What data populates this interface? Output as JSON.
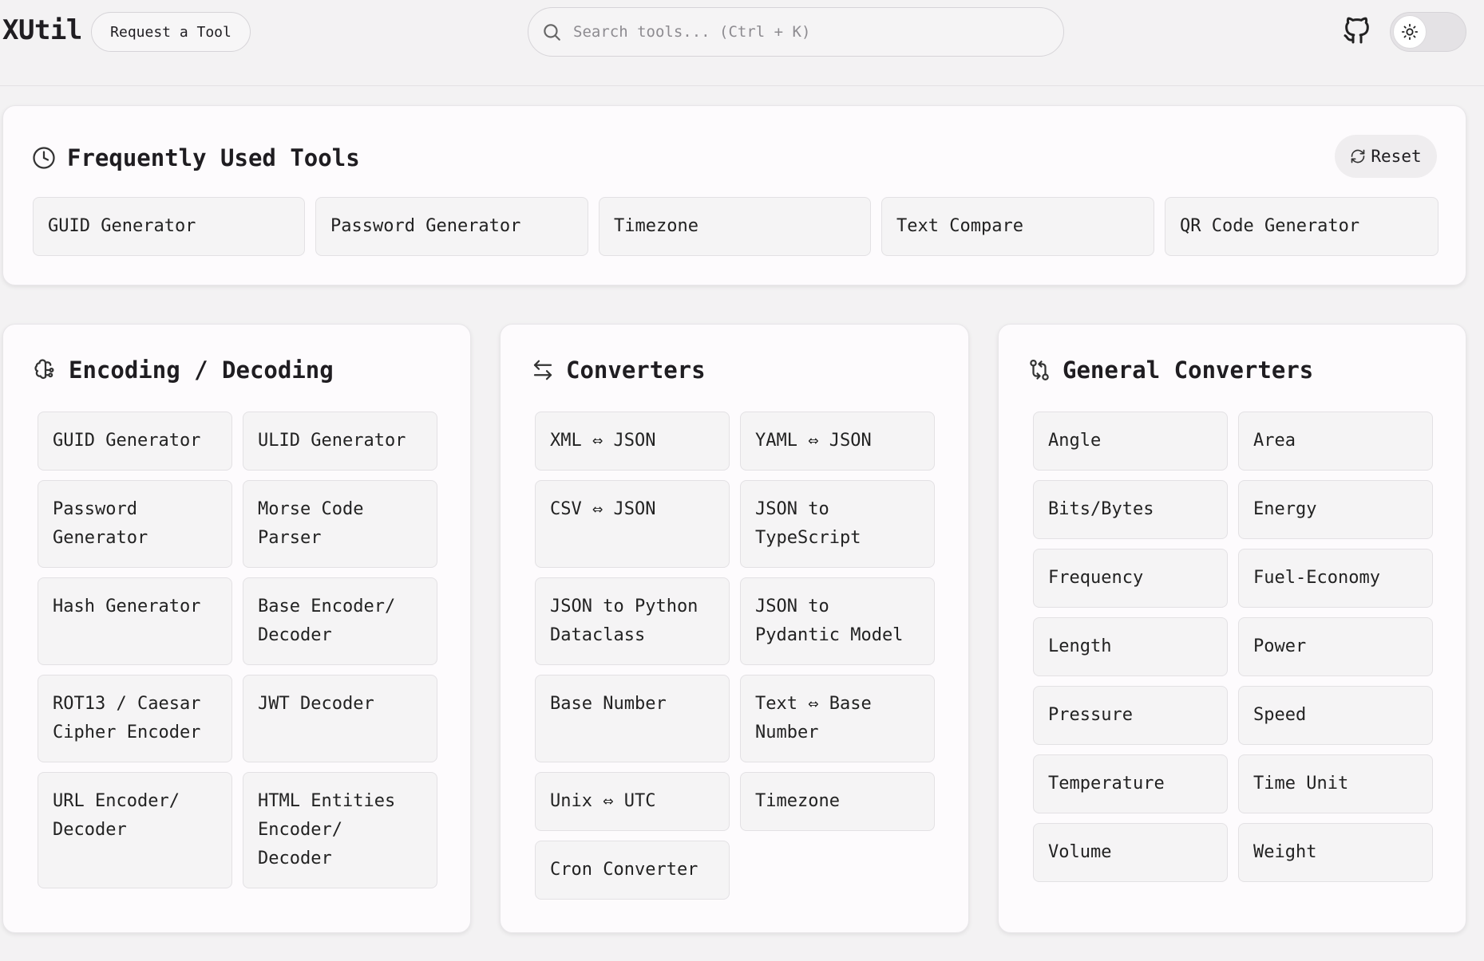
{
  "header": {
    "logo": "XUtil",
    "request_tool": "Request a Tool",
    "search_placeholder": "Search tools... (Ctrl + K)"
  },
  "frequent": {
    "title": "Frequently Used Tools",
    "reset": "Reset",
    "tools": [
      "GUID Generator",
      "Password Generator",
      "Timezone",
      "Text Compare",
      "QR Code Generator"
    ]
  },
  "encoding": {
    "title": "Encoding / Decoding",
    "tools": [
      "GUID Generator",
      "ULID Generator",
      "Password Generator",
      "Morse Code Parser",
      "Hash Generator",
      "Base Encoder/ Decoder",
      "ROT13 / Caesar Cipher Encoder",
      "JWT Decoder",
      "URL Encoder/ Decoder",
      "HTML Entities Encoder/ Decoder"
    ]
  },
  "converters": {
    "title": "Converters",
    "tools": [
      "XML ⇔ JSON",
      "YAML ⇔ JSON",
      "CSV ⇔ JSON",
      "JSON to TypeScript",
      "JSON to Python Dataclass",
      "JSON to Pydantic Model",
      "Base Number",
      "Text ⇔ Base Number",
      "Unix ⇔ UTC",
      "Timezone",
      "Cron Converter"
    ]
  },
  "general": {
    "title": "General Converters",
    "tools": [
      "Angle",
      "Area",
      "Bits/Bytes",
      "Energy",
      "Frequency",
      "Fuel-Economy",
      "Length",
      "Power",
      "Pressure",
      "Speed",
      "Temperature",
      "Time Unit",
      "Volume",
      "Weight"
    ]
  }
}
